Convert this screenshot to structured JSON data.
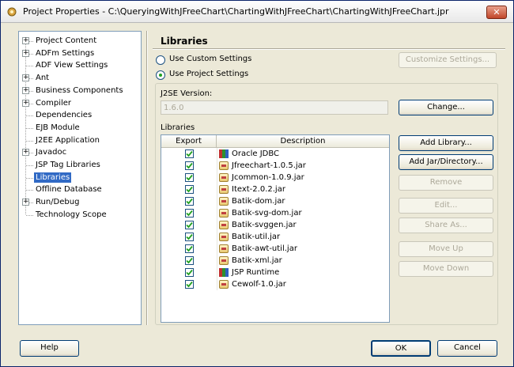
{
  "window": {
    "title": "Project Properties - C:\\QueryingWithJFreeChart\\ChartingWithJFreeChart\\ChartingWithJFreeChart.jpr",
    "close_label": "✕"
  },
  "tree": {
    "items": [
      {
        "label": "Project Content",
        "expandable": true
      },
      {
        "label": "ADFm Settings",
        "expandable": true
      },
      {
        "label": "ADF View Settings",
        "expandable": false
      },
      {
        "label": "Ant",
        "expandable": true
      },
      {
        "label": "Business Components",
        "expandable": true
      },
      {
        "label": "Compiler",
        "expandable": true
      },
      {
        "label": "Dependencies",
        "expandable": false
      },
      {
        "label": "EJB Module",
        "expandable": false
      },
      {
        "label": "J2EE Application",
        "expandable": false
      },
      {
        "label": "Javadoc",
        "expandable": true
      },
      {
        "label": "JSP Tag Libraries",
        "expandable": false
      },
      {
        "label": "Libraries",
        "expandable": false,
        "selected": true
      },
      {
        "label": "Offline Database",
        "expandable": false
      },
      {
        "label": "Run/Debug",
        "expandable": true
      },
      {
        "label": "Technology Scope",
        "expandable": false
      }
    ]
  },
  "panel": {
    "title": "Libraries",
    "radio_custom": "Use Custom Settings",
    "radio_project": "Use Project Settings",
    "customize_button": "Customize Settings...",
    "j2se_label": "J2SE Version:",
    "j2se_value": "1.6.0",
    "change_button": "Change...",
    "libraries_label": "Libraries",
    "col_export": "Export",
    "col_description": "Description",
    "rows": [
      {
        "name": "Oracle JDBC",
        "icon": "library",
        "checked": true
      },
      {
        "name": "Jfreechart-1.0.5.jar",
        "icon": "jar",
        "checked": true
      },
      {
        "name": "Jcommon-1.0.9.jar",
        "icon": "jar",
        "checked": true
      },
      {
        "name": "Itext-2.0.2.jar",
        "icon": "jar",
        "checked": true
      },
      {
        "name": "Batik-dom.jar",
        "icon": "jar",
        "checked": true
      },
      {
        "name": "Batik-svg-dom.jar",
        "icon": "jar",
        "checked": true
      },
      {
        "name": "Batik-svggen.jar",
        "icon": "jar",
        "checked": true
      },
      {
        "name": "Batik-util.jar",
        "icon": "jar",
        "checked": true
      },
      {
        "name": "Batik-awt-util.jar",
        "icon": "jar",
        "checked": true
      },
      {
        "name": "Batik-xml.jar",
        "icon": "jar",
        "checked": true
      },
      {
        "name": "JSP Runtime",
        "icon": "library",
        "checked": true
      },
      {
        "name": "Cewolf-1.0.jar",
        "icon": "jar",
        "checked": true
      }
    ],
    "add_library_button": "Add Library...",
    "add_jar_button": "Add Jar/Directory...",
    "remove_button": "Remove",
    "edit_button": "Edit...",
    "share_button": "Share As...",
    "move_up_button": "Move Up",
    "move_down_button": "Move Down"
  },
  "footer": {
    "help_button": "Help",
    "ok_button": "OK",
    "cancel_button": "Cancel"
  },
  "colors": {
    "selection": "#316ac5",
    "dialog_bg": "#ece9d8",
    "check_mark": "#21a121"
  }
}
